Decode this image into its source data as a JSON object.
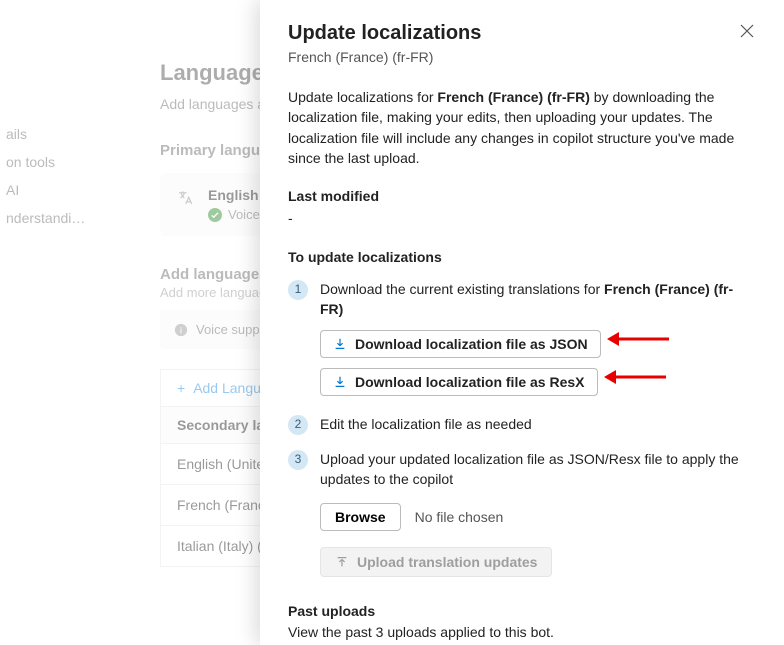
{
  "nav": {
    "items": [
      "ails",
      "on tools",
      "AI",
      "nderstandi…"
    ]
  },
  "main": {
    "title": "Languages",
    "subtitle": "Add languages and c",
    "primary_h": "Primary language",
    "primary_lang": "English (Unit",
    "voice_feat": "Voice feat",
    "add_h": "Add languages",
    "add_sub": "Add more languages",
    "voice_support": "Voice support is",
    "add_btn": "Add Langua",
    "secondary_h": "Secondary langua",
    "rows": [
      "English (United Kin",
      "French (France) (fr-",
      "Italian (Italy) (it-IT)"
    ]
  },
  "panel": {
    "title": "Update localizations",
    "subtitle": "French (France) (fr-FR)",
    "desc_a": "Update localizations for ",
    "desc_b": "French (France) (fr-FR)",
    "desc_c": " by downloading the localization file, making your edits, then uploading your updates. The localization file will include any changes in copilot structure you've made since the last upload.",
    "last_modified_label": "Last modified",
    "last_modified": "-",
    "steps_h": "To update localizations",
    "step1_a": "Download the current existing translations for ",
    "step1_b": "French (France) (fr-FR)",
    "dl_json": "Download localization file as JSON",
    "dl_resx": "Download localization file as ResX",
    "step2": "Edit the localization file as needed",
    "step3": "Upload your updated localization file as JSON/Resx file to apply the updates to the copilot",
    "browse": "Browse",
    "no_file": "No file chosen",
    "upload": "Upload translation updates",
    "past_h": "Past uploads",
    "past_text": "View the past 3 uploads applied to this bot."
  }
}
